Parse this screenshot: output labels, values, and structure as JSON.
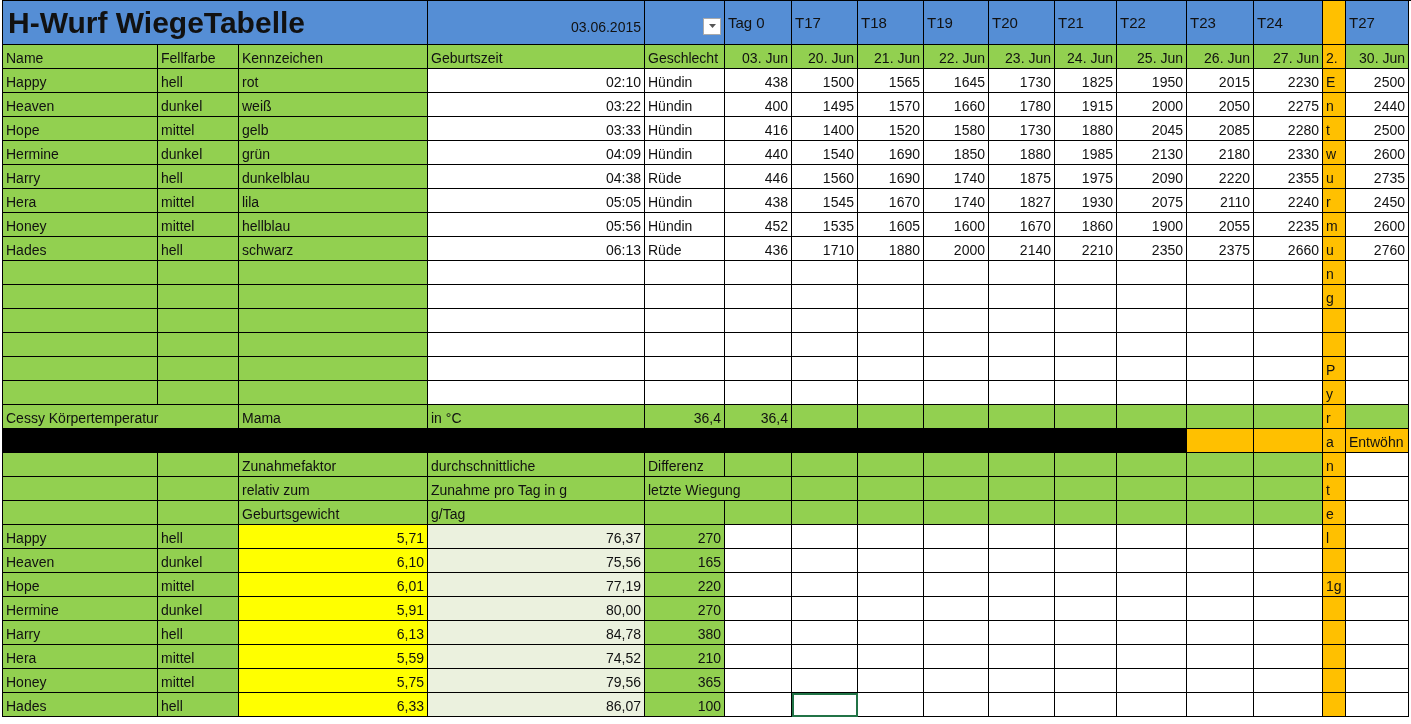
{
  "rows": [
    {
      "kind": "title",
      "A": "H-Wurf WiegeTabelle",
      "D": "03.06.2015",
      "E_filter": true,
      "F": "Tag 0",
      "G": "T17",
      "H": "T18",
      "I": "T19",
      "J": "T20",
      "K": "T21",
      "L": "T22",
      "M": "T23",
      "N": "T24",
      "P": "T27"
    },
    {
      "kind": "dates",
      "A": "Name",
      "B": "Fellfarbe",
      "C": "Kennzeichen",
      "D": "Geburtszeit",
      "E": "Geschlecht",
      "F": "03. Jun",
      "G": "20. Jun",
      "H": "21. Jun",
      "I": "22. Jun",
      "J": "23. Jun",
      "K": "24. Jun",
      "L": "25. Jun",
      "M": "26. Jun",
      "N": "27. Jun",
      "O": "2.",
      "P": "30. Jun"
    },
    {
      "kind": "weights",
      "A": "Happy",
      "B": "hell",
      "C": "rot",
      "D": "02:10",
      "E": "Hündin",
      "F": "438",
      "G": "1500",
      "H": "1565",
      "I": "1645",
      "J": "1730",
      "K": "1825",
      "L": "1950",
      "M": "2015",
      "N": "2230",
      "O": "E",
      "P": "2500"
    },
    {
      "kind": "weights",
      "A": "Heaven",
      "B": "dunkel",
      "C": "weiß",
      "D": "03:22",
      "E": "Hündin",
      "F": "400",
      "G": "1495",
      "H": "1570",
      "I": "1660",
      "J": "1780",
      "K": "1915",
      "L": "2000",
      "M": "2050",
      "N": "2275",
      "O": "n",
      "P": "2440"
    },
    {
      "kind": "weights",
      "A": "Hope",
      "B": "mittel",
      "C": "gelb",
      "D": "03:33",
      "E": "Hündin",
      "F": "416",
      "G": "1400",
      "H": "1520",
      "I": "1580",
      "J": "1730",
      "K": "1880",
      "L": "2045",
      "M": "2085",
      "N": "2280",
      "O": "t",
      "P": "2500"
    },
    {
      "kind": "weights",
      "A": "Hermine",
      "B": "dunkel",
      "C": "grün",
      "D": "04:09",
      "E": "Hündin",
      "F": "440",
      "G": "1540",
      "H": "1690",
      "I": "1850",
      "J": "1880",
      "K": "1985",
      "L": "2130",
      "M": "2180",
      "N": "2330",
      "O": "w",
      "P": "2600"
    },
    {
      "kind": "weights",
      "A": "Harry",
      "B": "hell",
      "C": "dunkelblau",
      "D": "04:38",
      "E": "Rüde",
      "F": "446",
      "G": "1560",
      "H": "1690",
      "I": "1740",
      "J": "1875",
      "K": "1975",
      "L": "2090",
      "M": "2220",
      "N": "2355",
      "O": "u",
      "P": "2735"
    },
    {
      "kind": "weights",
      "A": "Hera",
      "B": "mittel",
      "C": "lila",
      "D": "05:05",
      "E": "Hündin",
      "F": "438",
      "G": "1545",
      "H": "1670",
      "I": "1740",
      "J": "1827",
      "K": "1930",
      "L": "2075",
      "M": "2110",
      "N": "2240",
      "O": "r",
      "P": "2450"
    },
    {
      "kind": "weights",
      "A": "Honey",
      "B": "mittel",
      "C": "hellblau",
      "D": "05:56",
      "E": "Hündin",
      "F": "452",
      "G": "1535",
      "H": "1605",
      "I": "1600",
      "J": "1670",
      "K": "1860",
      "L": "1900",
      "M": "2055",
      "N": "2235",
      "O": "m",
      "P": "2600"
    },
    {
      "kind": "weights",
      "A": "Hades",
      "B": "hell",
      "C": "schwarz",
      "D": "06:13",
      "E": "Rüde",
      "F": "436",
      "G": "1710",
      "H": "1880",
      "I": "2000",
      "J": "2140",
      "K": "2210",
      "L": "2350",
      "M": "2375",
      "N": "2660",
      "O": "u",
      "P": "2760"
    },
    {
      "kind": "blank",
      "O": "n"
    },
    {
      "kind": "blank",
      "O": "g"
    },
    {
      "kind": "blank"
    },
    {
      "kind": "blank"
    },
    {
      "kind": "blank",
      "O": "P"
    },
    {
      "kind": "blank",
      "O": "y"
    },
    {
      "kind": "temp",
      "A": "Cessy Körpertemperatur",
      "C": "Mama",
      "D": "in °C",
      "E": "36,4",
      "F": "36,4",
      "O": "r"
    },
    {
      "kind": "divider",
      "O": "a",
      "P": "Entwöhn"
    },
    {
      "kind": "labels",
      "C": "Zunahmefaktor",
      "D": "durchschnittliche",
      "E": "Differenz",
      "O": "n"
    },
    {
      "kind": "labels",
      "C": "relativ zum",
      "D": "Zunahme pro Tag in g",
      "E": "letzte Wiegung",
      "O": "t"
    },
    {
      "kind": "labels",
      "C": "Geburtsgewicht",
      "D": "g/Tag",
      "O": "e"
    },
    {
      "kind": "stats",
      "A": "Happy",
      "B": "hell",
      "C": "5,71",
      "D": "76,37",
      "E": "270",
      "O": "l"
    },
    {
      "kind": "stats",
      "A": "Heaven",
      "B": "dunkel",
      "C": "6,10",
      "D": "75,56",
      "E": "165"
    },
    {
      "kind": "stats",
      "A": "Hope",
      "B": "mittel",
      "C": "6,01",
      "D": "77,19",
      "E": "220",
      "O": "1g"
    },
    {
      "kind": "stats",
      "A": "Hermine",
      "B": "dunkel",
      "C": "5,91",
      "D": "80,00",
      "E": "270"
    },
    {
      "kind": "stats",
      "A": "Harry",
      "B": "hell",
      "C": "6,13",
      "D": "84,78",
      "E": "380"
    },
    {
      "kind": "stats",
      "A": "Hera",
      "B": "mittel",
      "C": "5,59",
      "D": "74,52",
      "E": "210"
    },
    {
      "kind": "stats",
      "A": "Honey",
      "B": "mittel",
      "C": "5,75",
      "D": "79,56",
      "E": "365"
    },
    {
      "kind": "stats",
      "A": "Hades",
      "B": "hell",
      "C": "6,33",
      "D": "86,07",
      "E": "100",
      "G_active": true
    }
  ]
}
